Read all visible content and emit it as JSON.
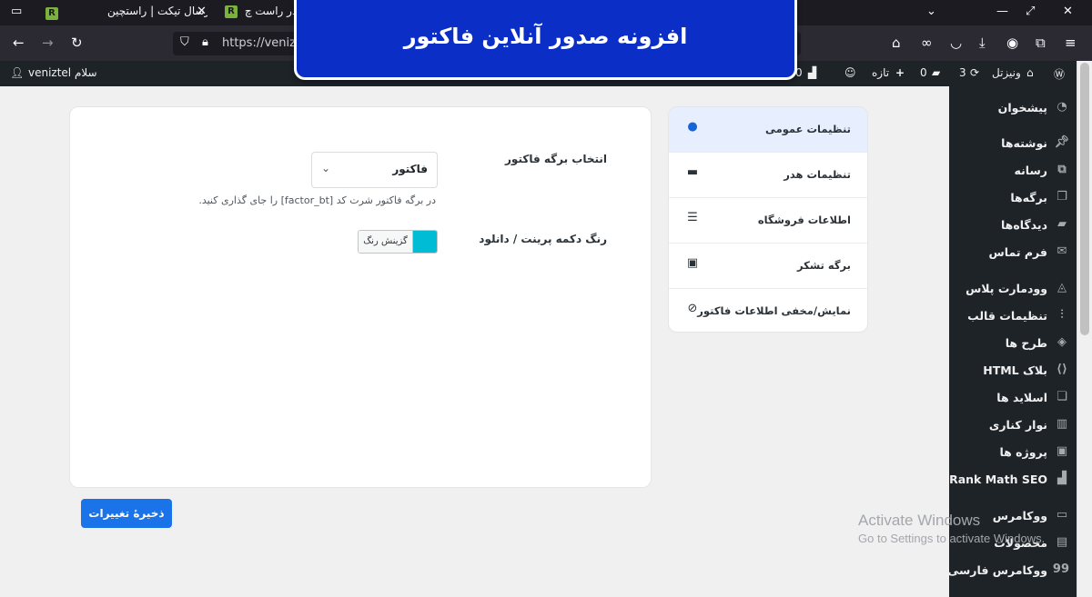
{
  "browser": {
    "tabs": [
      {
        "label": "ارسال تیکت | راستچین",
        "favicon": "R"
      },
      {
        "label": "در راست چ",
        "favicon": "R"
      }
    ],
    "url": "https://veniztel"
  },
  "banner": {
    "title": "افزونه صدور آنلاین فاکتور"
  },
  "adminbar": {
    "greeting": "سلام veniztel",
    "site_name": "ونیزتل",
    "updates_count": "3",
    "comments_count": "0",
    "new_label": "تازه",
    "extra_count": "0"
  },
  "sidebar": {
    "items": [
      {
        "label": "پیشخوان",
        "icon": "dashboard-icon"
      },
      {
        "label": "نوشته‌ها",
        "icon": "pin-icon"
      },
      {
        "label": "رسانه",
        "icon": "media-icon"
      },
      {
        "label": "برگه‌ها",
        "icon": "pages-icon"
      },
      {
        "label": "دیدگاه‌ها",
        "icon": "comments-icon"
      },
      {
        "label": "فرم تماس",
        "icon": "mail-icon"
      },
      {
        "label": "وودمارت پلاس",
        "icon": "woodmart-icon"
      },
      {
        "label": "تنظیمات قالب",
        "icon": "sliders-icon"
      },
      {
        "label": "طرح ها",
        "icon": "layers-icon"
      },
      {
        "label": "بلاک HTML",
        "icon": "code-icon"
      },
      {
        "label": "اسلاید ها",
        "icon": "slides-icon"
      },
      {
        "label": "نوار کناری",
        "icon": "sidebar-icon"
      },
      {
        "label": "پروژه ها",
        "icon": "portfolio-icon"
      },
      {
        "label": "Rank Math SEO",
        "icon": "rankmath-icon"
      },
      {
        "label": "ووکامرس",
        "icon": "woo-icon"
      },
      {
        "label": "محصولات",
        "icon": "archive-icon"
      },
      {
        "label": "ووکامرس فارسی",
        "icon": "persian-woo-icon"
      }
    ]
  },
  "settings_tabs": [
    {
      "label": "تنظیمات عمومی",
      "icon": "globe-icon",
      "active": true
    },
    {
      "label": "تنظیمات هدر",
      "icon": "monitor-icon",
      "active": false
    },
    {
      "label": "اطلاعات فروشگاه",
      "icon": "list-icon",
      "active": false
    },
    {
      "label": "برگه تشکر",
      "icon": "thanks-icon",
      "active": false
    },
    {
      "label": "نمایش/مخفی اطلاعات فاکتور",
      "icon": "eye-slash-icon",
      "active": false
    }
  ],
  "form": {
    "invoice_page_label": "انتخاب برگه فاکتور",
    "invoice_page_value": "فاکتور",
    "help_text": "در برگه فاکتور شرت کد [factor_bt] را جای گذاری کنید.",
    "button_color_label": "رنگ دکمه پرینت / دانلود",
    "color_button_label": "گزینش رنگ",
    "color_value": "#00bcd4"
  },
  "save_button": "ذخیرهٔ تغییرات",
  "watermark": {
    "line1": "Activate Windows",
    "line2": "Go to Settings to activate Windows."
  }
}
